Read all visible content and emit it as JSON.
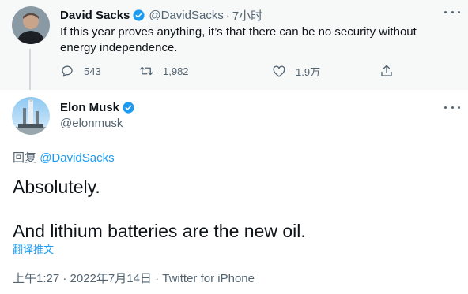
{
  "parent_tweet": {
    "author_name": "David Sacks",
    "handle": "@DavidSacks",
    "separator": "·",
    "time_ago": "7小时",
    "text": "If this year proves anything, it’s that there can be no security without energy independence.",
    "actions": {
      "reply_count": "543",
      "retweet_count": "1,982",
      "like_count": "1.9万"
    }
  },
  "main_tweet": {
    "author_name": "Elon Musk",
    "handle": "@elonmusk",
    "reply_prefix": "回复",
    "reply_to": "@DavidSacks",
    "text_line1": "Absolutely.",
    "text_line2": "And lithium batteries are the new oil.",
    "translate_label": "翻译推文",
    "timestamp": "上午1:27 · 2022年7月14日 · Twitter for iPhone"
  },
  "colors": {
    "verified": "#1d9bf0",
    "muted": "#536471",
    "link": "#1d9bf0",
    "parent_background": "#f7f9f9"
  },
  "icons": [
    "verified-badge-icon",
    "more-icon",
    "reply-icon",
    "retweet-icon",
    "like-icon",
    "share-icon"
  ]
}
